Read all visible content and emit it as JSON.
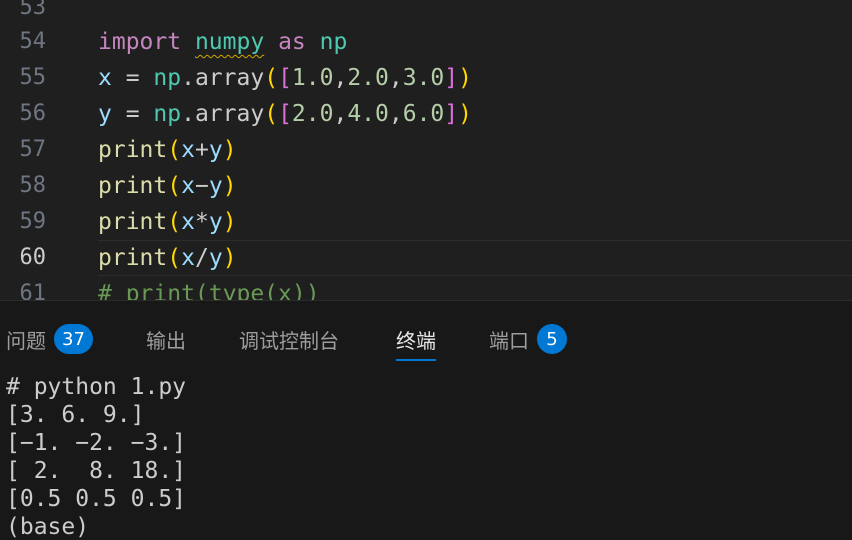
{
  "editor": {
    "lines": [
      {
        "number": "53"
      },
      {
        "number": "54",
        "t1": "import",
        "t2": "numpy",
        "t3": "as",
        "t4": "np"
      },
      {
        "number": "55",
        "t1": "x",
        "t2": " = ",
        "t3": "np",
        "t4": ".array",
        "t5": "(",
        "t6": "[",
        "t7": "1.0",
        "t8": ",",
        "t9": "2.0",
        "t10": ",",
        "t11": "3.0",
        "t12": "]",
        "t13": ")"
      },
      {
        "number": "56",
        "t1": "y",
        "t2": " = ",
        "t3": "np",
        "t4": ".array",
        "t5": "(",
        "t6": "[",
        "t7": "2.0",
        "t8": ",",
        "t9": "4.0",
        "t10": ",",
        "t11": "6.0",
        "t12": "]",
        "t13": ")"
      },
      {
        "number": "57",
        "t1": "print",
        "t2": "(",
        "t3": "x",
        "t4": "+",
        "t5": "y",
        "t6": ")"
      },
      {
        "number": "58",
        "t1": "print",
        "t2": "(",
        "t3": "x",
        "t4": "−",
        "t5": "y",
        "t6": ")"
      },
      {
        "number": "59",
        "t1": "print",
        "t2": "(",
        "t3": "x",
        "t4": "*",
        "t5": "y",
        "t6": ")"
      },
      {
        "number": "60",
        "t1": "print",
        "t2": "(",
        "t3": "x",
        "t4": "/",
        "t5": "y",
        "t6": ")"
      },
      {
        "number": "61",
        "t1": "# print(type(x))"
      }
    ]
  },
  "panel": {
    "tabs": [
      {
        "label": "问题",
        "badge": "37"
      },
      {
        "label": "输出"
      },
      {
        "label": "调试控制台"
      },
      {
        "label": "终端"
      },
      {
        "label": "端口",
        "badge": "5"
      }
    ],
    "terminal_lines": [
      "# python 1.py",
      "[3. 6. 9.]",
      "[−1. −2. −3.]",
      "[ 2.  8. 18.]",
      "[0.5 0.5 0.5]",
      "(base)"
    ]
  },
  "colors": {
    "accent": "#0078d4",
    "keyword": "#c586c0",
    "variable": "#9cdcfe",
    "function": "#dcdcaa",
    "number": "#b5cea8",
    "comment": "#6a9955"
  }
}
